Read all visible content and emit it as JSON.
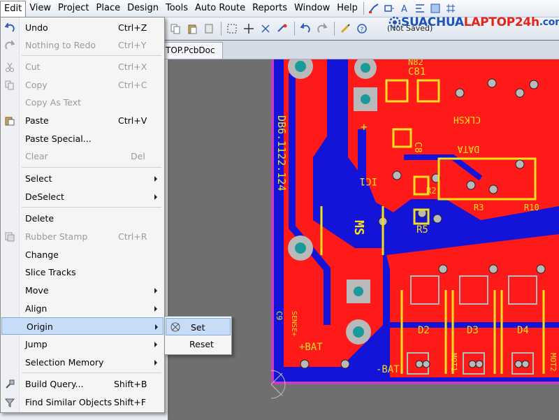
{
  "menubar": {
    "items": [
      "Edit",
      "View",
      "Project",
      "Place",
      "Design",
      "Tools",
      "Auto Route",
      "Reports",
      "Window",
      "Help"
    ],
    "active_index": 0
  },
  "logo": {
    "part1": "SUACHUA",
    "part2": "LAPTOP24h",
    "part3": ".com"
  },
  "status": {
    "not_saved": "(Not Saved)"
  },
  "document_tab": {
    "label": "TOP.PcbDoc"
  },
  "edit_menu": {
    "items": [
      {
        "label": "Undo",
        "shortcut": "Ctrl+Z",
        "icon": "undo-icon",
        "enabled": true,
        "submenu": false
      },
      {
        "label": "Nothing to Redo",
        "shortcut": "Ctrl+Y",
        "icon": "redo-icon",
        "enabled": false,
        "submenu": false
      },
      {
        "label": "Cut",
        "shortcut": "Ctrl+X",
        "icon": "scissors-icon",
        "enabled": false,
        "submenu": false
      },
      {
        "label": "Copy",
        "shortcut": "Ctrl+C",
        "icon": "copy-icon",
        "enabled": false,
        "submenu": false
      },
      {
        "label": "Copy As Text",
        "shortcut": "",
        "icon": "",
        "enabled": false,
        "submenu": false
      },
      {
        "label": "Paste",
        "shortcut": "Ctrl+V",
        "icon": "paste-icon",
        "enabled": true,
        "submenu": false
      },
      {
        "label": "Paste Special...",
        "shortcut": "",
        "icon": "",
        "enabled": true,
        "submenu": false
      },
      {
        "label": "Clear",
        "shortcut": "Del",
        "icon": "",
        "enabled": false,
        "submenu": false
      },
      {
        "label": "Select",
        "shortcut": "",
        "icon": "",
        "enabled": true,
        "submenu": true
      },
      {
        "label": "DeSelect",
        "shortcut": "",
        "icon": "",
        "enabled": true,
        "submenu": true
      },
      {
        "label": "Delete",
        "shortcut": "",
        "icon": "",
        "enabled": true,
        "submenu": false
      },
      {
        "label": "Rubber Stamp",
        "shortcut": "Ctrl+R",
        "icon": "rubber-stamp-icon",
        "enabled": false,
        "submenu": false
      },
      {
        "label": "Change",
        "shortcut": "",
        "icon": "",
        "enabled": true,
        "submenu": false
      },
      {
        "label": "Slice Tracks",
        "shortcut": "",
        "icon": "",
        "enabled": true,
        "submenu": false
      },
      {
        "label": "Move",
        "shortcut": "",
        "icon": "",
        "enabled": true,
        "submenu": true
      },
      {
        "label": "Align",
        "shortcut": "",
        "icon": "",
        "enabled": true,
        "submenu": true
      },
      {
        "label": "Origin",
        "shortcut": "",
        "icon": "",
        "enabled": true,
        "submenu": true
      },
      {
        "label": "Jump",
        "shortcut": "",
        "icon": "",
        "enabled": true,
        "submenu": true
      },
      {
        "label": "Selection Memory",
        "shortcut": "",
        "icon": "",
        "enabled": true,
        "submenu": true
      },
      {
        "label": "Build Query...",
        "shortcut": "Shift+B",
        "icon": "build-query-icon",
        "enabled": true,
        "submenu": false
      },
      {
        "label": "Find Similar Objects",
        "shortcut": "Shift+F",
        "icon": "filter-icon",
        "enabled": true,
        "submenu": false
      }
    ]
  },
  "origin_submenu": {
    "items": [
      {
        "label": "Set",
        "icon": "origin-marker-icon"
      },
      {
        "label": "Reset",
        "icon": ""
      }
    ]
  },
  "pcb_labels": {
    "c81": "C81",
    "c8": "C8",
    "r5": "R5",
    "ms": "MS",
    "ic1": "IC1",
    "d2": "D2",
    "d3": "D3",
    "d4": "D4",
    "bat_plus": "+BAT",
    "bat_minus": "-BAT",
    "clksh": "CLKSH",
    "data": "DATA",
    "board_id": "DB6.1122.124",
    "r3": "R3",
    "r2": "R2",
    "r10": "R10",
    "n82": "N82",
    "c9": "C9",
    "sense_lbl": "SENSE+",
    "mot1": "MOT1",
    "mot2": "MOT2",
    "lbl_plus": "+"
  },
  "colors": {
    "board_red": "#ff1a1a",
    "board_blue": "#1414d8",
    "silkscreen_yellow": "#f0e020",
    "pad_teal": "#1a9a9a",
    "menu_highlight": "#c6dcf7"
  }
}
